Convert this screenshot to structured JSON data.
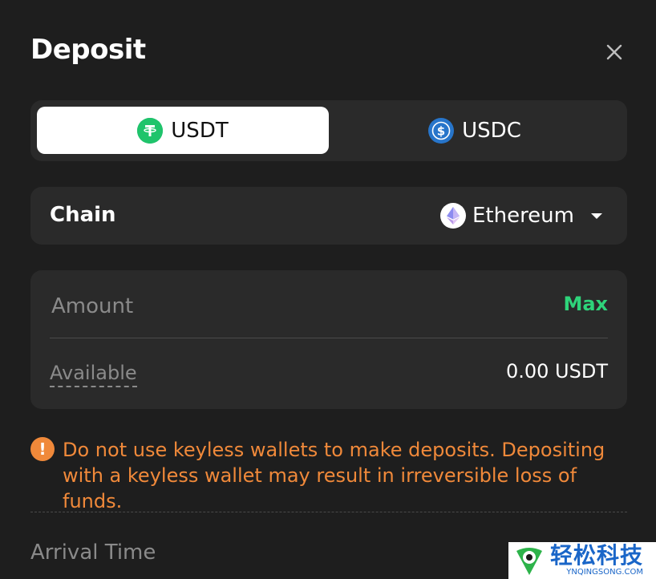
{
  "header": {
    "title": "Deposit",
    "close_icon": "close-icon"
  },
  "tabs": [
    {
      "label": "USDT",
      "icon": "usdt-coin-icon",
      "active": true,
      "color": "#26a17b"
    },
    {
      "label": "USDC",
      "icon": "usdc-coin-icon",
      "active": false,
      "color": "#2775ca"
    }
  ],
  "chain": {
    "label": "Chain",
    "selected": "Ethereum",
    "icon": "ethereum-icon",
    "dropdown_icon": "caret-down-icon"
  },
  "amount": {
    "placeholder": "Amount",
    "value": "",
    "max_label": "Max",
    "available_label": "Available",
    "available_value": "0.00 USDT"
  },
  "warning": {
    "icon": "exclamation-icon",
    "text": "Do not use keyless wallets to make deposits. Depositing with a keyless wallet may result in irreversible loss of funds."
  },
  "arrival": {
    "label": "Arrival Time"
  },
  "watermark": {
    "text_cn": "轻松科技",
    "text_en": "YNQINGSONG.COM"
  },
  "colors": {
    "background": "#1e1e1e",
    "card": "#2a2a2a",
    "accent_green": "#2ed47a",
    "warning_orange": "#f0893a"
  }
}
